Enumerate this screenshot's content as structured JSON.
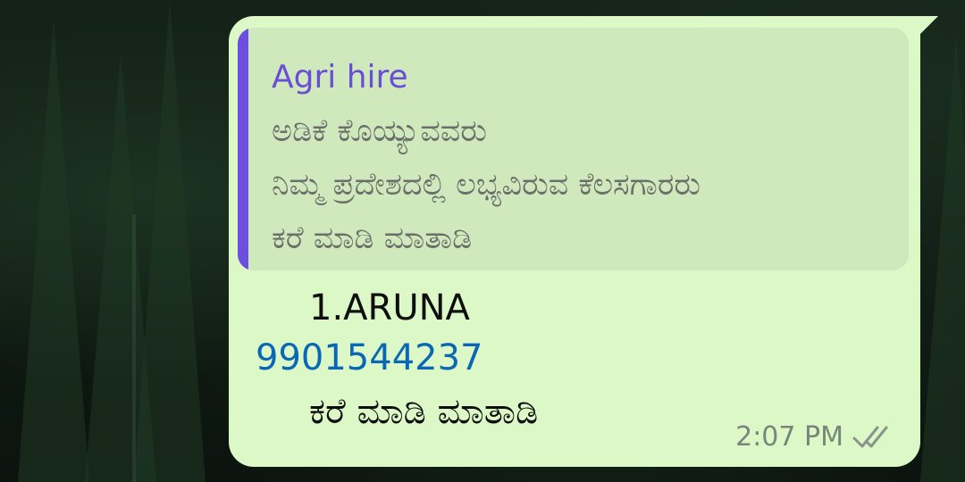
{
  "colors": {
    "bubble": "#dcf8c6",
    "quote_background": "#cfe9bd",
    "quote_bar": "#6c4ee0",
    "sender_name": "#6a4ed8",
    "link": "#0a67b6"
  },
  "message": {
    "quoted": {
      "sender": "Agri hire",
      "lines": [
        "ಅಡಿಕೆ ಕೊಯ್ಯುವವರು",
        "ನಿಮ್ಮ ಪ್ರದೇಶದಲ್ಲಿ ಲಭ್ಯವಿರುವ ಕೆಲಸಗಾರರು",
        "ಕರೆ ಮಾಡಿ ಮಾತಾಡಿ"
      ]
    },
    "body": {
      "name_line": "1.ARUNA",
      "phone": "9901544237",
      "call_line": "ಕರೆ ಮಾಡಿ ಮಾತಾಡಿ"
    },
    "time": "2:07 PM",
    "status_icon": "double-check-icon"
  }
}
